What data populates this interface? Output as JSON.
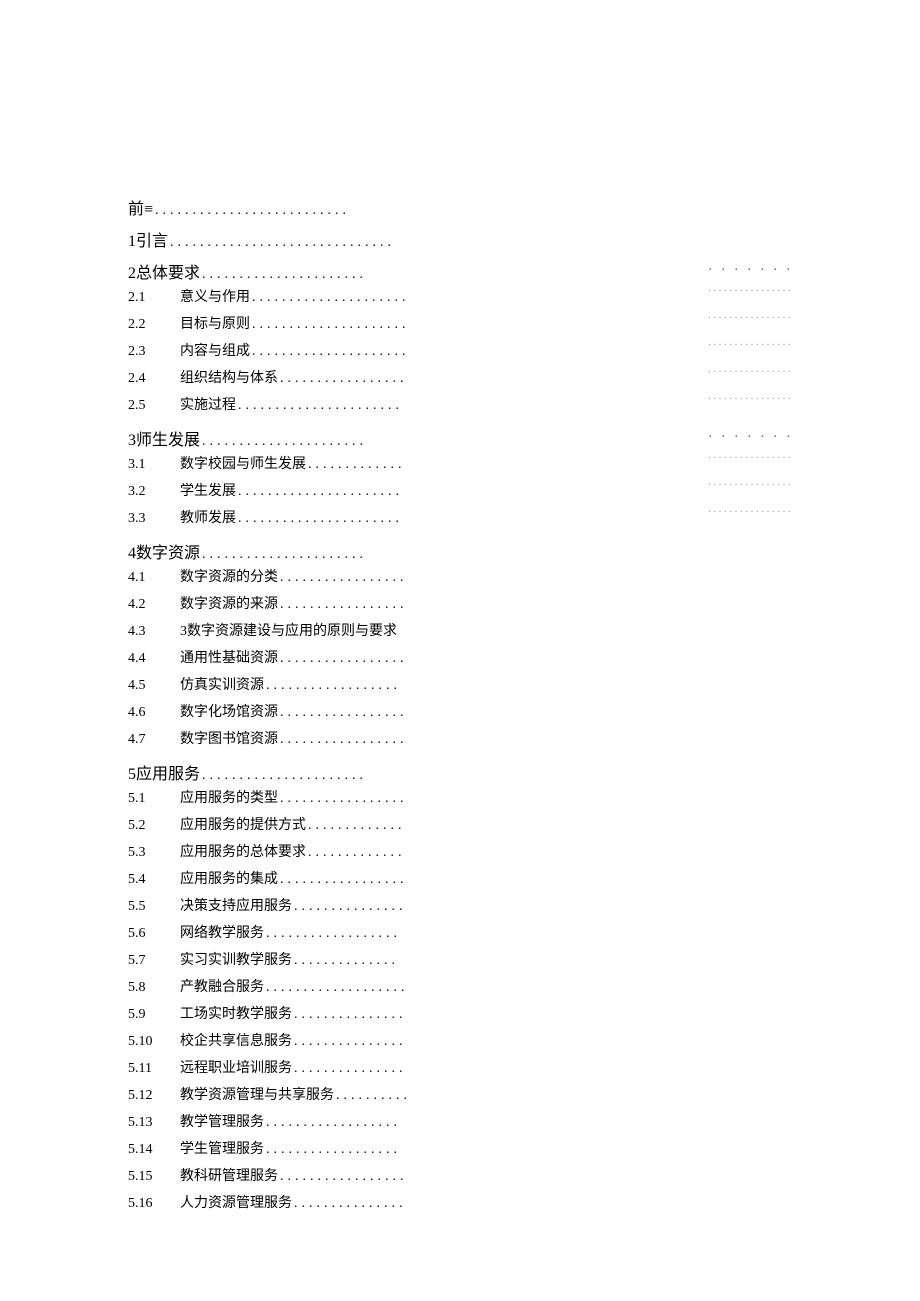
{
  "toc": [
    {
      "kind": "section",
      "num": "",
      "label": "前≡",
      "dots": 26,
      "right": null
    },
    {
      "kind": "section",
      "num": "",
      "label": "1引言",
      "dots": 30,
      "right": null
    },
    {
      "kind": "section",
      "num": "",
      "label": "2总体要求",
      "dots": 22,
      "right": "a"
    },
    {
      "kind": "item",
      "num": "2.1",
      "label": "意义与作用",
      "dots": 21,
      "right": "b"
    },
    {
      "kind": "item",
      "num": "2.2",
      "label": "目标与原则",
      "dots": 21,
      "right": "b"
    },
    {
      "kind": "item",
      "num": "2.3",
      "label": "内容与组成",
      "dots": 21,
      "right": "b"
    },
    {
      "kind": "item",
      "num": "2.4",
      "label": "组织结构与体系",
      "dots": 17,
      "right": "b"
    },
    {
      "kind": "item",
      "num": "2.5",
      "label": "实施过程",
      "dots": 22,
      "right": "b"
    },
    {
      "kind": "section",
      "num": "",
      "label": "3师生发展",
      "dots": 22,
      "right": "a"
    },
    {
      "kind": "item",
      "num": "3.1",
      "label": "数字校园与师生发展",
      "dots": 13,
      "right": "b"
    },
    {
      "kind": "item",
      "num": "3.2",
      "label": "学生发展",
      "dots": 22,
      "right": "b"
    },
    {
      "kind": "item",
      "num": "3.3",
      "label": "教师发展",
      "dots": 22,
      "right": "b"
    },
    {
      "kind": "section",
      "num": "",
      "label": "4数字资源",
      "dots": 22,
      "right": null
    },
    {
      "kind": "item",
      "num": "4.1",
      "label": "数字资源的分类",
      "dots": 17,
      "right": null
    },
    {
      "kind": "item",
      "num": "4.2",
      "label": "数字资源的来源",
      "dots": 17,
      "right": null
    },
    {
      "kind": "item",
      "num": "4.3",
      "label": "3数字资源建设与应用的原则与要求",
      "dots": 0,
      "right": null
    },
    {
      "kind": "item",
      "num": "4.4",
      "label": "通用性基础资源",
      "dots": 17,
      "right": null
    },
    {
      "kind": "item",
      "num": "4.5",
      "label": "仿真实训资源",
      "dots": 18,
      "right": null
    },
    {
      "kind": "item",
      "num": "4.6",
      "label": "数字化场馆资源",
      "dots": 17,
      "right": null
    },
    {
      "kind": "item",
      "num": "4.7",
      "label": "数字图书馆资源",
      "dots": 17,
      "right": null
    },
    {
      "kind": "section",
      "num": "",
      "label": "5应用服务",
      "dots": 22,
      "right": null
    },
    {
      "kind": "item",
      "num": "5.1",
      "label": "应用服务的类型",
      "dots": 17,
      "right": null
    },
    {
      "kind": "item",
      "num": "5.2",
      "label": "应用服务的提供方式",
      "dots": 13,
      "right": null
    },
    {
      "kind": "item",
      "num": "5.3",
      "label": "应用服务的总体要求",
      "dots": 13,
      "right": null
    },
    {
      "kind": "item",
      "num": "5.4",
      "label": "应用服务的集成",
      "dots": 17,
      "right": null
    },
    {
      "kind": "item",
      "num": "5.5",
      "label": "决策支持应用服务",
      "dots": 15,
      "right": null
    },
    {
      "kind": "item",
      "num": "5.6",
      "label": "网络教学服务",
      "dots": 18,
      "right": null
    },
    {
      "kind": "item",
      "num": "5.7",
      "label": "实习实训教学服务",
      "dots": 14,
      "right": null
    },
    {
      "kind": "item",
      "num": "5.8",
      "label": "产教融合服务",
      "dots": 19,
      "right": null
    },
    {
      "kind": "item",
      "num": "5.9",
      "label": "工场实时教学服务",
      "dots": 15,
      "right": null
    },
    {
      "kind": "item",
      "num": "5.10",
      "label": "校企共享信息服务",
      "dots": 15,
      "right": null
    },
    {
      "kind": "item",
      "num": "5.11",
      "label": "远程职业培训服务",
      "dots": 15,
      "right": null
    },
    {
      "kind": "item",
      "num": "5.12",
      "label": "教学资源管理与共享服务",
      "dots": 10,
      "right": null
    },
    {
      "kind": "item",
      "num": "5.13",
      "label": "教学管理服务",
      "dots": 18,
      "right": null
    },
    {
      "kind": "item",
      "num": "5.14",
      "label": "学生管理服务",
      "dots": 18,
      "right": null
    },
    {
      "kind": "item",
      "num": "5.15",
      "label": "教科研管理服务",
      "dots": 17,
      "right": null
    },
    {
      "kind": "item",
      "num": "5.16",
      "label": "人力资源管理服务",
      "dots": 15,
      "right": null
    }
  ]
}
